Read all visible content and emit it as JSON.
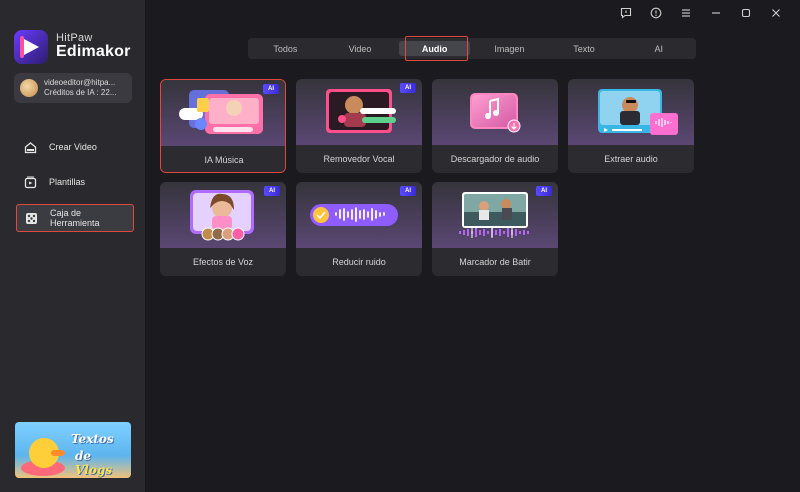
{
  "brand": {
    "sub": "HitPaw",
    "name": "Edimakor"
  },
  "account": {
    "email": "videoeditor@hitpa...",
    "credits": "Créditos de IA : 22..."
  },
  "nav": [
    {
      "label": "Crear Video",
      "icon": "home-icon",
      "active": false
    },
    {
      "label": "Plantillas",
      "icon": "templates-icon",
      "active": false
    },
    {
      "label": "Caja de Herramienta",
      "icon": "toolbox-icon",
      "active": true
    }
  ],
  "promo": {
    "line1": "Textos",
    "line2_prefix": "de ",
    "line2_highlight": "Vlogs"
  },
  "tabs": [
    "Todos",
    "Video",
    "Audio",
    "Imagen",
    "Texto",
    "AI"
  ],
  "active_tab": "Audio",
  "ai_badge": "AI",
  "tools": [
    {
      "label": "IA Música",
      "ai": true,
      "selected": true
    },
    {
      "label": "Removedor Vocal",
      "ai": true,
      "selected": false
    },
    {
      "label": "Descargador de audio",
      "ai": false,
      "selected": false
    },
    {
      "label": "Extraer audio",
      "ai": false,
      "selected": false
    },
    {
      "label": "Efectos de Voz",
      "ai": true,
      "selected": false
    },
    {
      "label": "Reducir ruido",
      "ai": true,
      "selected": false
    },
    {
      "label": "Marcador de Batir",
      "ai": true,
      "selected": false
    }
  ],
  "colors": {
    "accent_red": "#e0493f",
    "ai_badge": "#4a3cf0",
    "sidebar_bg": "#2a2a2e",
    "main_bg": "#1b1b1f"
  }
}
